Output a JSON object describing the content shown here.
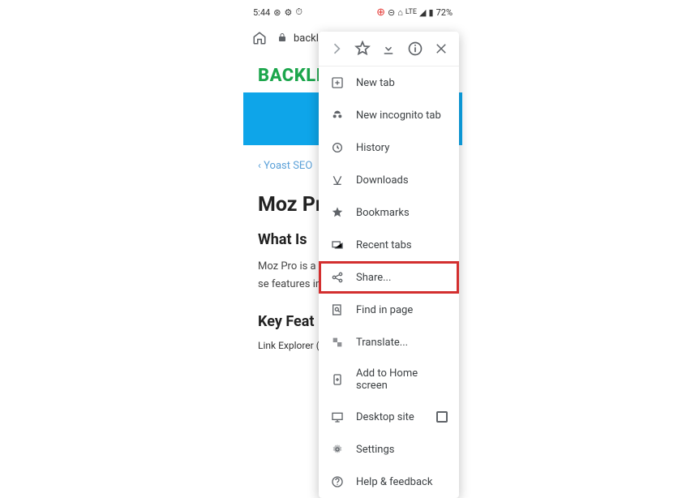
{
  "status": {
    "time": "5:44",
    "lte": "LTE",
    "battery": "72%"
  },
  "browser": {
    "url": "backli"
  },
  "page": {
    "logo": "BACKLI",
    "yoast": "Yoast SEO",
    "title": "Moz Pr",
    "subtitle": "What Is ",
    "body": "Moz Pro is a software suite to improve se features inclu Explorer and",
    "keyfeat": "Key Feat",
    "cutoff": "Link Explorer (replaces OSE)"
  },
  "menu": {
    "top": {},
    "items": {
      "newtab": "New tab",
      "incognito": "New incognito tab",
      "history": "History",
      "downloads": "Downloads",
      "bookmarks": "Bookmarks",
      "recenttabs": "Recent tabs",
      "share": "Share...",
      "findinpage": "Find in page",
      "translate": "Translate...",
      "addhome": "Add to Home screen",
      "desktop": "Desktop site",
      "settings": "Settings",
      "help": "Help & feedback"
    }
  }
}
